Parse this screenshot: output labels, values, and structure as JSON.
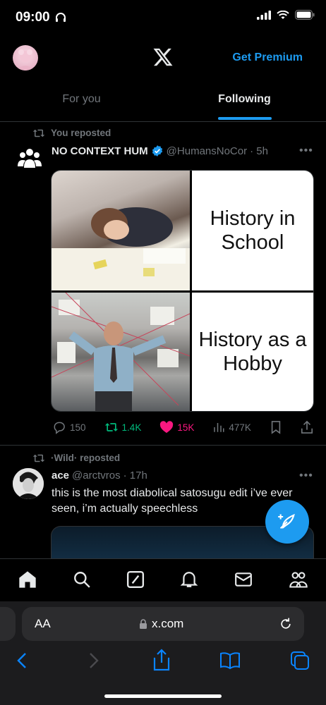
{
  "status": {
    "time": "09:00"
  },
  "header": {
    "premium_label": "Get Premium"
  },
  "tabs": [
    {
      "label": "For you",
      "active": false
    },
    {
      "label": "Following",
      "active": true
    }
  ],
  "posts": [
    {
      "repost_label": "You reposted",
      "author": "NO CONTEXT HUM",
      "verified": true,
      "handle": "@HumansNoCor",
      "time": "· 5h",
      "meme": {
        "top_text": "History in School",
        "bottom_text": "History as a Hobby"
      },
      "stats": {
        "replies": "150",
        "reposts": "1.4K",
        "likes": "15K",
        "views": "477K"
      }
    },
    {
      "repost_label": "·Wild· reposted",
      "author": "ace",
      "handle": "@arctvros",
      "time": "· 17h",
      "text": "this is the most diabolical satosugu edit i’ve ever seen, i’m actually speechless"
    }
  ],
  "browser": {
    "aa": "AA",
    "url": "x.com"
  },
  "colors": {
    "accent": "#1d9bf0",
    "repost": "#00ba7c",
    "like": "#f91880",
    "background": "#000000"
  }
}
